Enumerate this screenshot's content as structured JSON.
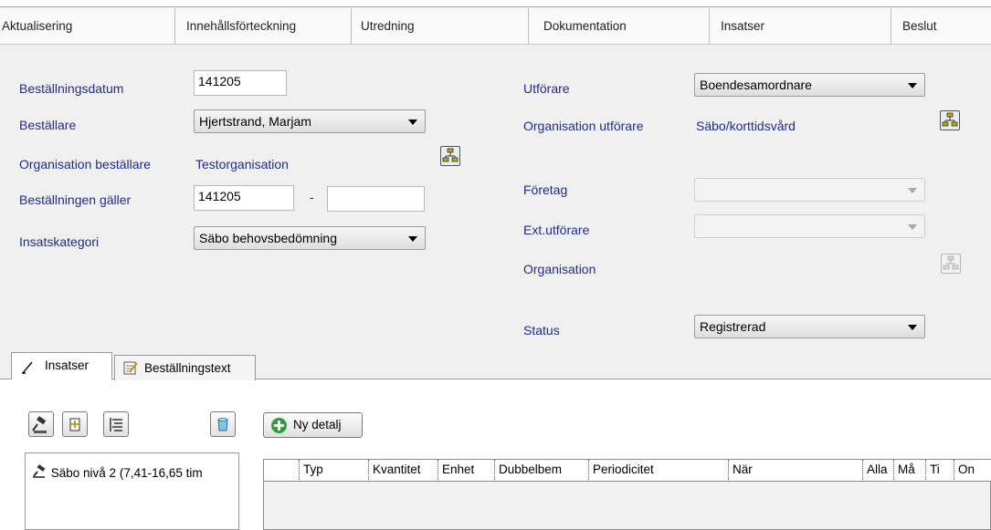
{
  "top_tabs": [
    "Aktualisering",
    "Innehållsförteckning",
    "Utredning",
    "Dokumentation",
    "Insatser",
    "Beslut"
  ],
  "form": {
    "bestallningsdatum": {
      "label": "Beställningsdatum",
      "value": "141205"
    },
    "bestallare": {
      "label": "Beställare",
      "value": "Hjertstrand, Marjam"
    },
    "org_bestallare": {
      "label": "Organisation beställare",
      "value": "Testorganisation"
    },
    "bestallningen_galler": {
      "label": "Beställningen gäller",
      "from": "141205",
      "separator": "-",
      "to": ""
    },
    "insatskategori": {
      "label": "Insatskategori",
      "value": "Säbo behovsbedömning"
    },
    "utforare": {
      "label": "Utförare",
      "value": "Boendesamordnare"
    },
    "org_utforare": {
      "label": "Organisation utförare",
      "value": "Säbo/korttidsvård"
    },
    "foretag": {
      "label": "Företag",
      "value": ""
    },
    "ext_utforare": {
      "label": "Ext.utförare",
      "value": ""
    },
    "organisation": {
      "label": "Organisation"
    },
    "status": {
      "label": "Status",
      "value": "Registrerad"
    }
  },
  "sub_tabs": [
    "Insatser",
    "Beställningstext"
  ],
  "toolbar": {
    "ny_detalj": "Ny detalj"
  },
  "tree": {
    "item": "Säbo nivå 2 (7,41-16,65 tim"
  },
  "grid": {
    "columns": [
      "Typ",
      "Kvantitet",
      "Enhet",
      "Dubbelbem",
      "Periodicitet",
      "När",
      "Alla",
      "Må",
      "Ti",
      "On"
    ]
  },
  "colors": {
    "label_blue": "#1f2d8c",
    "button_icon_bg": "#e8eef8"
  }
}
